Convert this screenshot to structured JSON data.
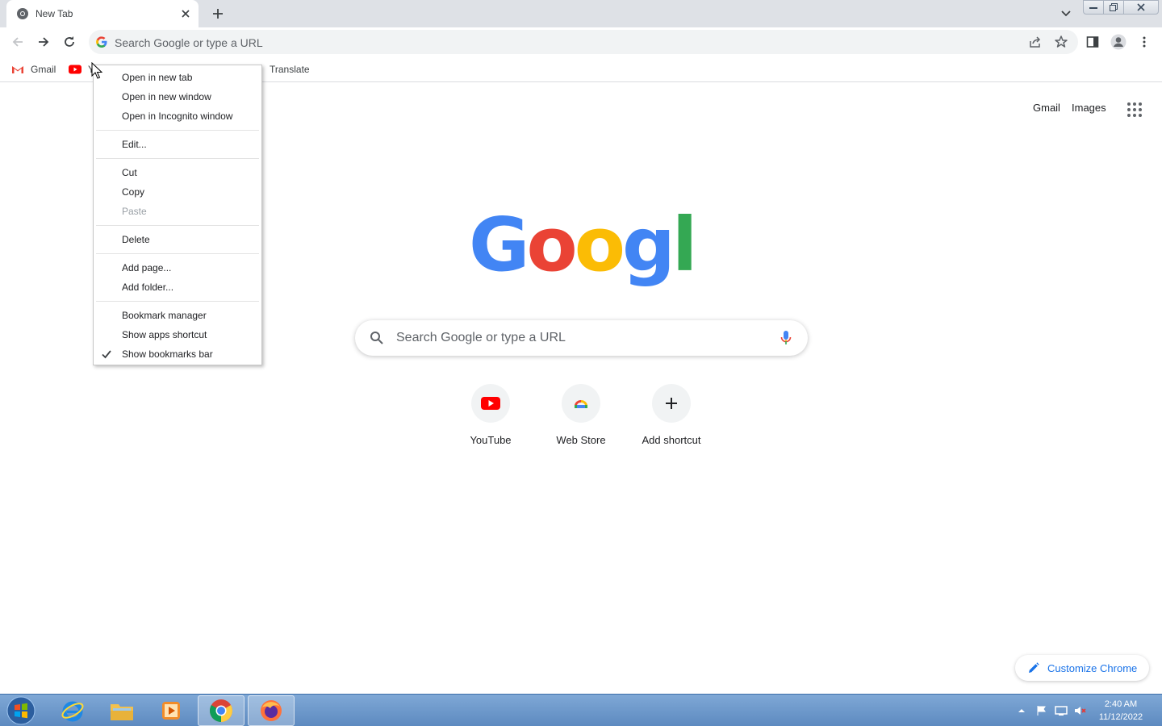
{
  "browser": {
    "tab": {
      "title": "New Tab"
    },
    "omnibox": {
      "placeholder": "Search Google or type a URL"
    }
  },
  "bookmarks": [
    {
      "label": "Gmail",
      "icon": "gmail-icon"
    },
    {
      "label": "Y",
      "icon": "youtube-icon"
    },
    {
      "label": "Translate",
      "icon": "translate-icon"
    }
  ],
  "context_menu": {
    "items": [
      {
        "label": "Open in new tab"
      },
      {
        "label": "Open in new window"
      },
      {
        "label": "Open in Incognito window"
      },
      {
        "label": "Edit..."
      },
      {
        "label": "Cut"
      },
      {
        "label": "Copy"
      },
      {
        "label": "Paste",
        "disabled": true
      },
      {
        "label": "Delete"
      },
      {
        "label": "Add page..."
      },
      {
        "label": "Add folder..."
      },
      {
        "label": "Bookmark manager"
      },
      {
        "label": "Show apps shortcut"
      },
      {
        "label": "Show bookmarks bar",
        "checked": true
      }
    ]
  },
  "page": {
    "top_links": {
      "gmail": "Gmail",
      "images": "Images"
    },
    "search_placeholder": "Search Google or type a URL",
    "shortcuts": [
      {
        "label": "YouTube",
        "icon": "youtube-icon"
      },
      {
        "label": "Web Store",
        "icon": "web-store-icon"
      },
      {
        "label": "Add shortcut",
        "icon": "plus-icon"
      }
    ],
    "customize_label": "Customize Chrome"
  },
  "taskbar": {
    "items": [
      "start-button",
      "internet-explorer-icon",
      "file-explorer-icon",
      "media-player-icon",
      "chrome-icon",
      "firefox-icon"
    ],
    "clock": {
      "time": "2:40 AM",
      "date": "11/12/2022"
    }
  },
  "colors": {
    "google_blue": "#4285F4",
    "google_red": "#EA4335",
    "google_yellow": "#FBBC05",
    "google_green": "#34A853",
    "link_blue": "#1a73e8"
  }
}
